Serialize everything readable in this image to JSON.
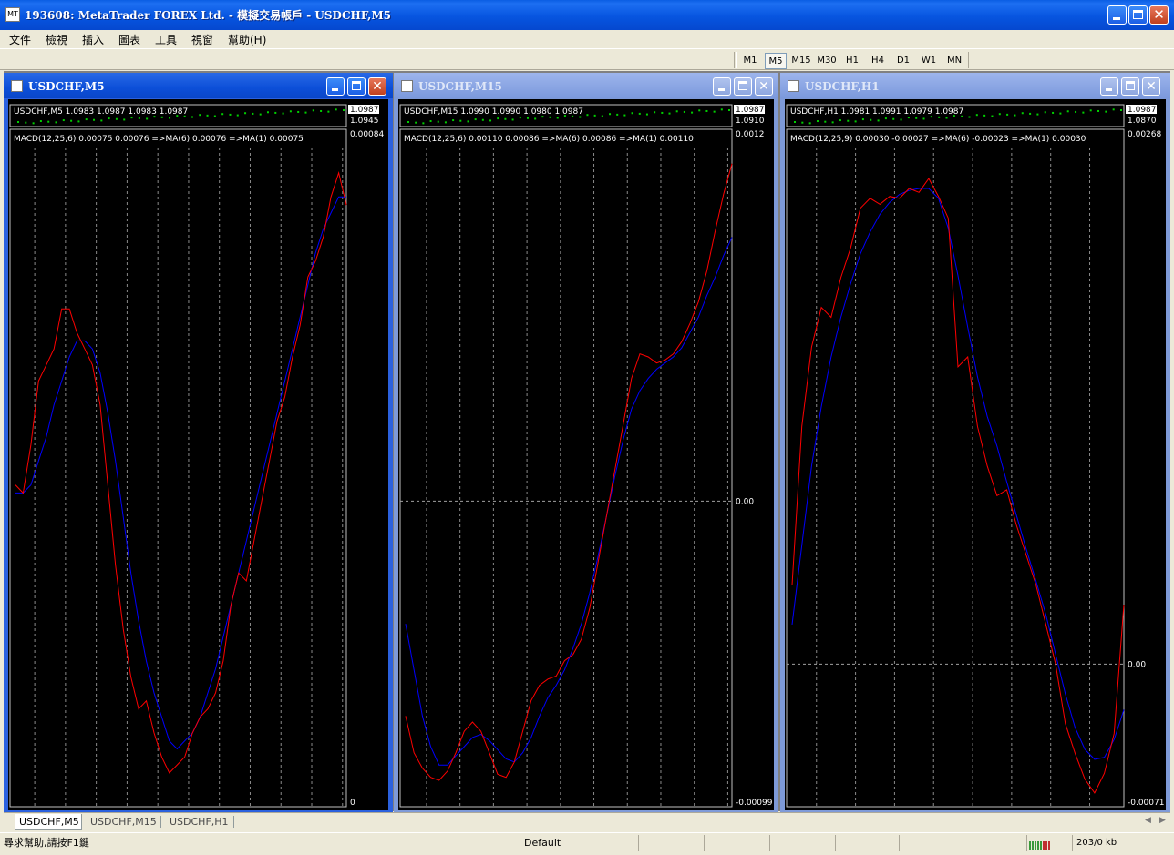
{
  "window": {
    "title": "193608: MetaTrader FOREX Ltd. - 模擬交易帳戶 - USDCHF,M5",
    "app_icon": "metatrader-icon"
  },
  "menu": [
    "文件",
    "檢視",
    "插入",
    "圖表",
    "工具",
    "視窗",
    "幫助(H)"
  ],
  "timeframes": [
    "M1",
    "M5",
    "M15",
    "M30",
    "H1",
    "H4",
    "D1",
    "W1",
    "MN"
  ],
  "active_timeframe": "M5",
  "charts": [
    {
      "title": "USDCHF,M5",
      "active": true,
      "price_info": "USDCHF,M5  1.0983 1.0987 1.0983 1.0987",
      "price_scale": [
        "1.0987",
        "1.0945"
      ],
      "indicator_info": "MACD(12,25,6) 0.00075 0.00076  =>MA(6) 0.00076  =>MA(1) 0.00075",
      "scale_labels": {
        "top": "0.00084",
        "bottom": "0"
      },
      "zero_label": "",
      "macd_red": [
        0.0004,
        0.00039,
        0.00045,
        0.00053,
        0.00055,
        0.00057,
        0.00062,
        0.00062,
        0.00059,
        0.00057,
        0.00055,
        0.0005,
        0.0004,
        0.0003,
        0.00022,
        0.00016,
        0.00012,
        0.00013,
        9e-05,
        6e-05,
        4e-05,
        5e-05,
        6e-05,
        9e-05,
        0.00011,
        0.00012,
        0.00014,
        0.00018,
        0.00025,
        0.00029,
        0.00028,
        0.00033,
        0.00038,
        0.00043,
        0.00048,
        0.00051,
        0.00056,
        0.0006,
        0.00066,
        0.00068,
        0.00071,
        0.00076,
        0.00079,
        0.00075
      ],
      "macd_blue": [
        0.00039,
        0.00039,
        0.0004,
        0.00043,
        0.00046,
        0.0005,
        0.00053,
        0.00056,
        0.00058,
        0.00058,
        0.00057,
        0.00054,
        0.00049,
        0.00043,
        0.00036,
        0.00029,
        0.00023,
        0.00018,
        0.00014,
        0.00011,
        8e-05,
        7e-05,
        8e-05,
        9e-05,
        0.00011,
        0.00014,
        0.00017,
        0.00021,
        0.00025,
        0.00029,
        0.00033,
        0.00037,
        0.00041,
        0.00045,
        0.00049,
        0.00053,
        0.00057,
        0.00061,
        0.00065,
        0.00069,
        0.00072,
        0.00074,
        0.00076,
        0.00076
      ],
      "ymin": 0,
      "ymax": 0.00084
    },
    {
      "title": "USDCHF,M15",
      "active": false,
      "price_info": "USDCHF,M15  1.0990 1.0990 1.0980 1.0987",
      "price_scale": [
        "1.0987",
        "1.0910"
      ],
      "indicator_info": "MACD(12,25,6) 0.00110 0.00086  =>MA(6) 0.00086  =>MA(1) 0.00110",
      "scale_labels": {
        "top": "0.0012",
        "bottom": "-0.00099"
      },
      "zero_label": "0.00",
      "macd_red": [
        -0.0007,
        -0.00082,
        -0.00087,
        -0.0009,
        -0.00091,
        -0.00088,
        -0.00082,
        -0.00075,
        -0.00072,
        -0.00075,
        -0.00082,
        -0.00089,
        -0.0009,
        -0.00085,
        -0.00075,
        -0.00065,
        -0.0006,
        -0.00058,
        -0.00057,
        -0.00052,
        -0.0005,
        -0.00045,
        -0.00035,
        -0.0002,
        -5e-05,
        0.0001,
        0.00025,
        0.0004,
        0.00048,
        0.00047,
        0.00045,
        0.00046,
        0.00048,
        0.00052,
        0.00058,
        0.00065,
        0.00075,
        0.00088,
        0.001,
        0.0011
      ],
      "macd_blue": [
        -0.0004,
        -0.00055,
        -0.0007,
        -0.0008,
        -0.00086,
        -0.00086,
        -0.00083,
        -0.0008,
        -0.00077,
        -0.00076,
        -0.00078,
        -0.00081,
        -0.00084,
        -0.00085,
        -0.00082,
        -0.00077,
        -0.0007,
        -0.00064,
        -0.0006,
        -0.00055,
        -0.00048,
        -0.0004,
        -0.0003,
        -0.00018,
        -5e-05,
        8e-05,
        0.0002,
        0.0003,
        0.00036,
        0.0004,
        0.00043,
        0.00045,
        0.00047,
        0.0005,
        0.00055,
        0.0006,
        0.00067,
        0.00073,
        0.0008,
        0.00086
      ],
      "ymin": -0.00099,
      "ymax": 0.0012
    },
    {
      "title": "USDCHF,H1",
      "active": false,
      "price_info": "USDCHF,H1  1.0981 1.0991 1.0979 1.0987",
      "price_scale": [
        "1.0987",
        "1.0870"
      ],
      "indicator_info": "MACD(12,25,9) 0.00030 -0.00027  =>MA(6) -0.00023  =>MA(1) 0.00030",
      "scale_labels": {
        "top": "0.00268",
        "bottom": "-0.00071"
      },
      "zero_label": "0.00",
      "macd_red": [
        0.0004,
        0.0012,
        0.0016,
        0.0018,
        0.00175,
        0.00195,
        0.0021,
        0.0023,
        0.00235,
        0.00232,
        0.00236,
        0.00235,
        0.0024,
        0.00238,
        0.00245,
        0.00236,
        0.00225,
        0.0015,
        0.00155,
        0.0012,
        0.001,
        0.00085,
        0.00088,
        0.0007,
        0.00055,
        0.0004,
        0.0002,
        0.0,
        -0.0003,
        -0.00045,
        -0.00058,
        -0.00065,
        -0.00055,
        -0.00035,
        0.0003
      ],
      "macd_blue": [
        0.0002,
        0.0006,
        0.001,
        0.0013,
        0.00155,
        0.00175,
        0.00192,
        0.00207,
        0.00218,
        0.00227,
        0.00233,
        0.00237,
        0.00239,
        0.0024,
        0.0024,
        0.00235,
        0.0022,
        0.00196,
        0.0017,
        0.00145,
        0.00125,
        0.0011,
        0.00092,
        0.00075,
        0.00058,
        0.00042,
        0.00025,
        5e-05,
        -0.00015,
        -0.00032,
        -0.00043,
        -0.00048,
        -0.00047,
        -0.00038,
        -0.00023
      ],
      "ymin": -0.00071,
      "ymax": 0.00268
    }
  ],
  "tabs": [
    "USDCHF,M5",
    "USDCHF,M15",
    "USDCHF,H1"
  ],
  "active_tab": "USDCHF,M5",
  "status": {
    "help": "尋求幫助,請按F1鍵",
    "profile": "Default",
    "traffic": "203/0 kb"
  },
  "colors": {
    "macd_main": "#ff0000",
    "macd_signal": "#0000ff",
    "chart_bg": "#000000",
    "price_dots": "#00d000"
  }
}
